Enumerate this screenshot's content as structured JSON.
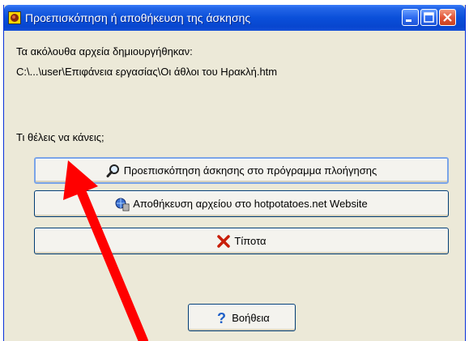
{
  "window": {
    "title": "Προεπισκόπηση ή αποθήκευση της άσκησης",
    "title_icon": "hotpotatoes-app-icon"
  },
  "titlebar_buttons": {
    "minimize_icon": "minimize-icon",
    "maximize_icon": "maximize-icon",
    "close_icon": "close-icon"
  },
  "content": {
    "created_label": "Τα ακόλουθα αρχεία δημιουργήθηκαν:",
    "file_path": "C:\\...\\user\\Επιφάνεια εργασίας\\Οι άθλοι του Ηρακλή.htm",
    "question": "Τι θέλεις να κάνεις;"
  },
  "buttons": {
    "preview": {
      "label": "Προεπισκόπηση άσκησης στο πρόγραμμα πλοήγησης",
      "icon": "magnifier-icon"
    },
    "save": {
      "label": "Αποθήκευση αρχείου στο hotpotatoes.net Website",
      "icon": "web-upload-icon"
    },
    "nothing": {
      "label": "Τίποτα",
      "icon": "red-x-icon"
    },
    "help": {
      "label": "Βοήθεια",
      "icon": "question-mark-icon"
    }
  },
  "colors": {
    "titlebar": "#0a4fd9",
    "dialog_bg": "#ece9d8",
    "annotation_arrow": "#ff0000"
  }
}
